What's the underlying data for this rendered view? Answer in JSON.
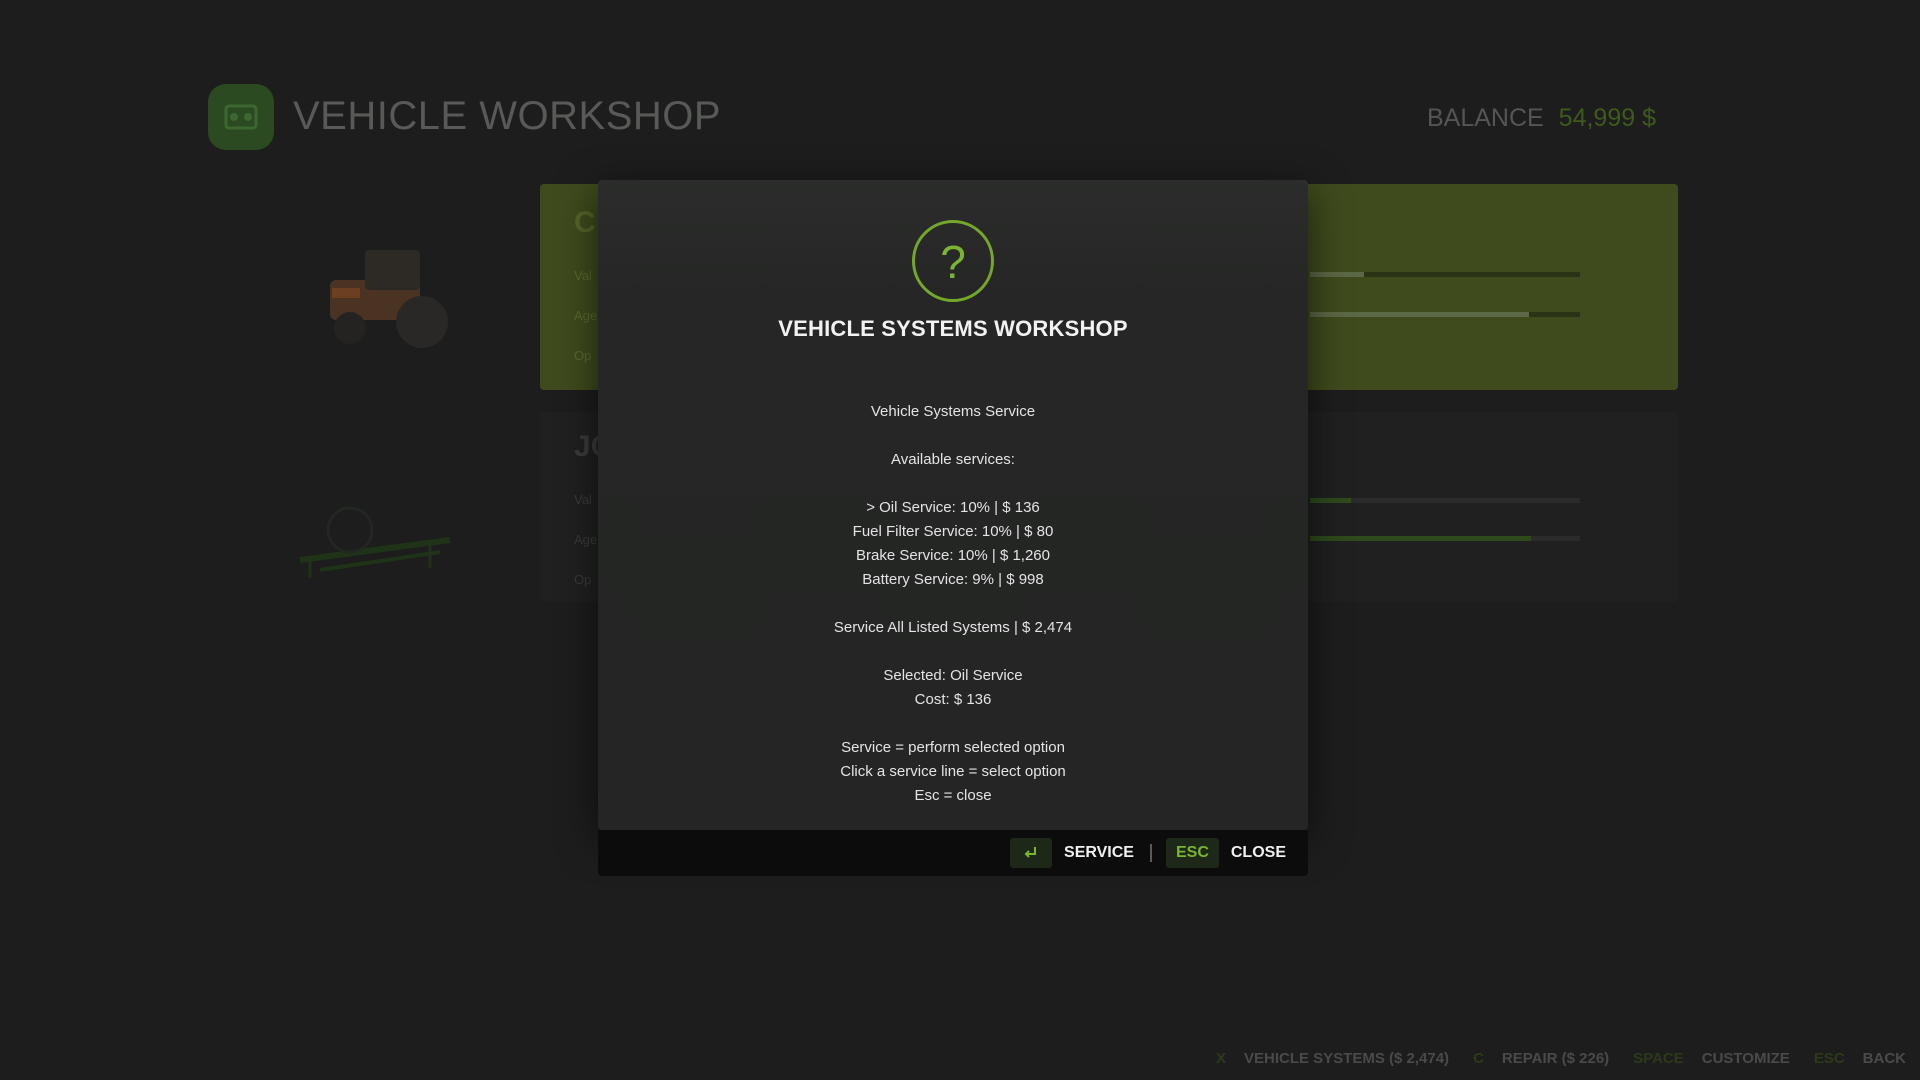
{
  "header": {
    "title": "VEHICLE WORKSHOP",
    "balance_label": "BALANCE",
    "balance_value": "54,999 $"
  },
  "bottom_hints": [
    {
      "key": "X",
      "label": "VEHICLE SYSTEMS ($ 2,474)"
    },
    {
      "key": "C",
      "label": "REPAIR ($ 226)"
    },
    {
      "key": "SPACE",
      "label": "CUSTOMIZE"
    },
    {
      "key": "ESC",
      "label": "BACK"
    }
  ],
  "dialog": {
    "icon": "question-icon",
    "title": "VEHICLE SYSTEMS WORKSHOP",
    "subtitle": "Vehicle Systems Service",
    "available_label": "Available services:",
    "services": [
      "> Oil Service: 10%  |  $ 136",
      "Fuel Filter Service: 10%  |  $ 80",
      "Brake Service: 10%  |  $ 1,260",
      "Battery Service: 9%  |  $ 998"
    ],
    "service_all": "Service All Listed Systems  |  $ 2,474",
    "selected": "Selected: Oil Service",
    "cost": "Cost: $ 136",
    "help": [
      "Service = perform selected option",
      "Click a service line = select option",
      "Esc = close"
    ],
    "footer": {
      "service_key_icon": "enter-key-icon",
      "service_label": "SERVICE",
      "close_key": "ESC",
      "close_label": "CLOSE"
    }
  },
  "colors": {
    "accent": "#7ab531",
    "background": "#1c1d1c",
    "dialog": "#252625"
  },
  "background_bars": {
    "active_card": [
      0.2,
      0.81
    ],
    "inactive_card": [
      0.15,
      0.82
    ]
  }
}
